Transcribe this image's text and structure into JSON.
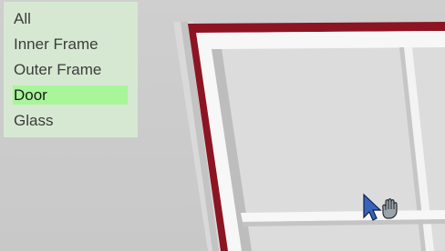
{
  "menu": {
    "items": [
      {
        "label": "All",
        "selected": false
      },
      {
        "label": "Inner Frame",
        "selected": false
      },
      {
        "label": "Outer Frame",
        "selected": false
      },
      {
        "label": "Door",
        "selected": true
      },
      {
        "label": "Glass",
        "selected": false
      }
    ]
  },
  "colors": {
    "viewport_bg": "#cccccc",
    "menu_bg": "#d6e8d2",
    "selected_bg": "#a8f59a",
    "frame_red": "#8c1423",
    "frame_white": "#f5f5f5"
  },
  "cursor": {
    "icon": "move-pointer-icon"
  }
}
